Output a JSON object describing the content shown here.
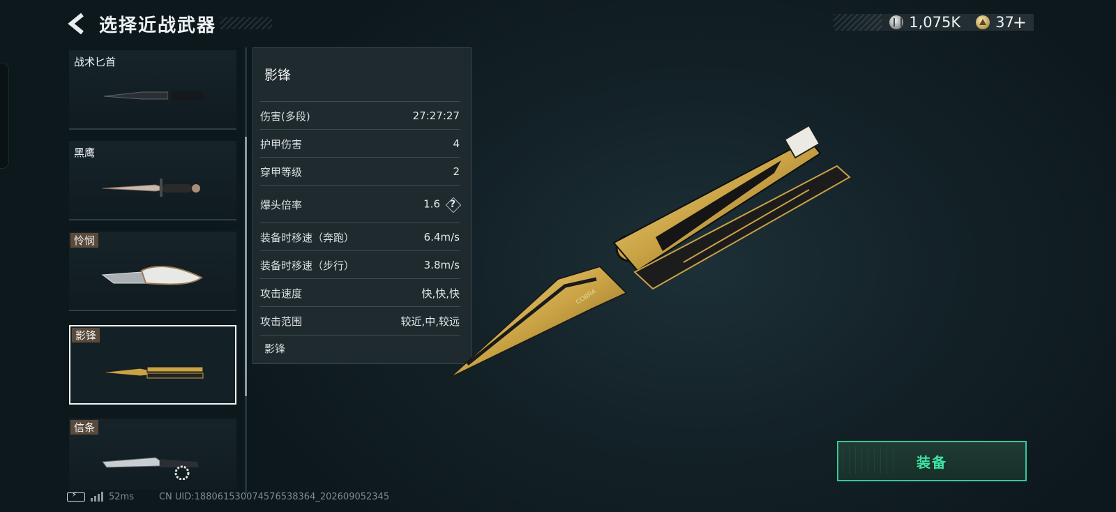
{
  "header": {
    "title": "选择近战武器"
  },
  "currency": [
    {
      "icon": "silver-coin-icon",
      "value": "1,075K"
    },
    {
      "icon": "gold-coin-icon",
      "value": "37",
      "suffix": "+"
    }
  ],
  "weapons": [
    {
      "name": "战术匕首",
      "tagged": false,
      "selected": false
    },
    {
      "name": "黑鹰",
      "tagged": false,
      "selected": false
    },
    {
      "name": "怜悯",
      "tagged": true,
      "selected": false
    },
    {
      "name": "影锋",
      "tagged": true,
      "selected": true
    },
    {
      "name": "信条",
      "tagged": true,
      "selected": false
    }
  ],
  "stats": {
    "title": "影锋",
    "rows": [
      {
        "label": "伤害(多段)",
        "value": "27:27:27"
      },
      {
        "label": "护甲伤害",
        "value": "4"
      },
      {
        "label": "穿甲等级",
        "value": "2"
      },
      {
        "label": "爆头倍率",
        "value": "1.6",
        "help": "?"
      },
      {
        "label": "装备时移速（奔跑）",
        "value": "6.4m/s"
      },
      {
        "label": "装备时移速（步行）",
        "value": "3.8m/s"
      },
      {
        "label": "攻击速度",
        "value": "快,快,快"
      },
      {
        "label": "攻击范围",
        "value": "较近,中,较远"
      }
    ],
    "footer": "影锋"
  },
  "preview": {
    "engraving": "COBRA"
  },
  "equip_button": {
    "label": "装备"
  },
  "status_bar": {
    "ping": "52ms",
    "uid": "CN UID:18806153007457653836‌4_202609052345"
  },
  "colors": {
    "accent_green": "#3fe3a6",
    "gold": "#c9a244",
    "panel": "#202b30"
  }
}
